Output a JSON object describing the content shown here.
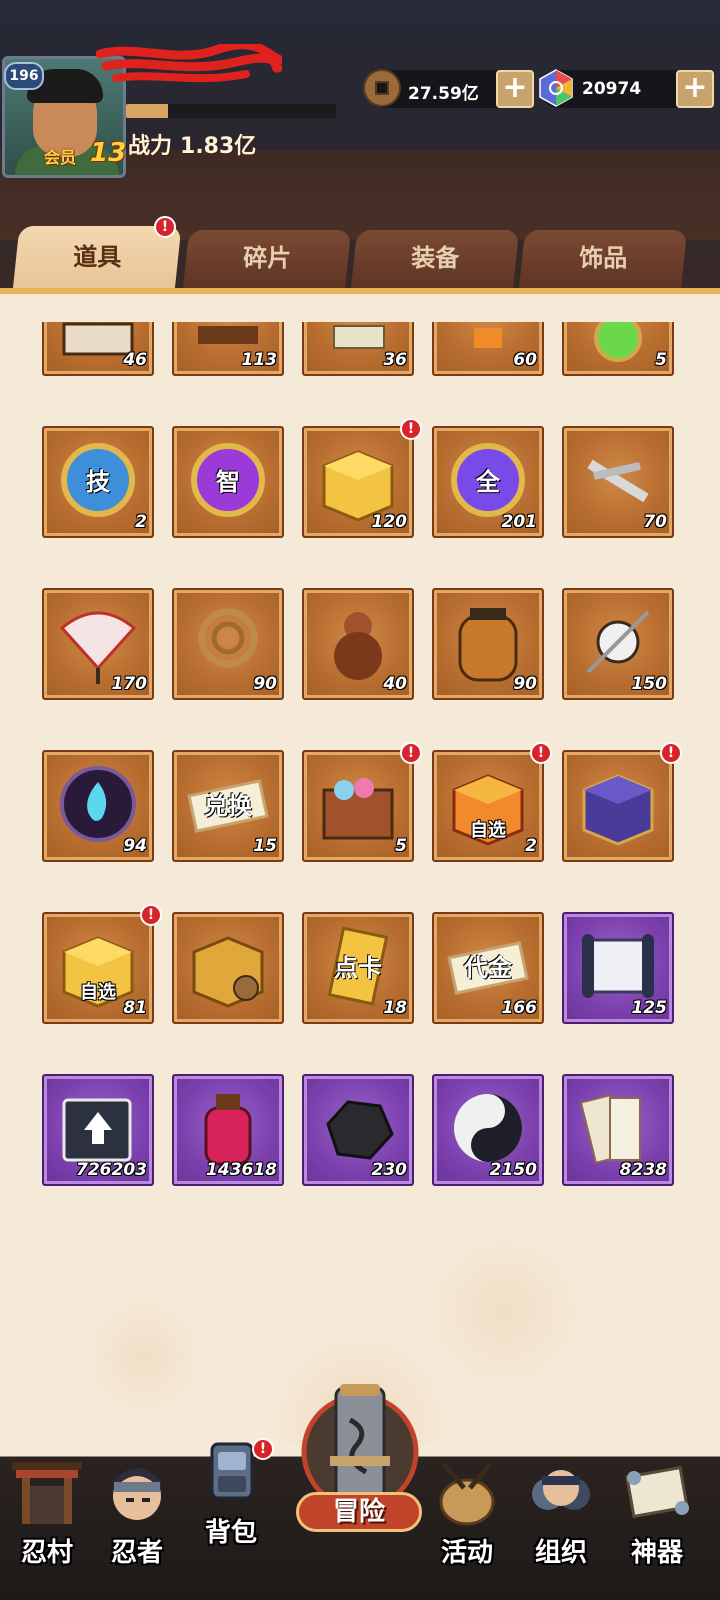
{
  "player": {
    "level": "196",
    "vip_label": "会员",
    "vip_level": "13",
    "power_label": "战力",
    "power_value": "1.83亿"
  },
  "currencies": [
    {
      "icon": "copper-coin-icon",
      "amount": "27.59亿",
      "plus": "+"
    },
    {
      "icon": "rainbow-gem-icon",
      "amount": "20974",
      "plus": "+"
    }
  ],
  "tabs": [
    {
      "label": "道具",
      "active": true,
      "alert": "!"
    },
    {
      "label": "碎片",
      "active": false
    },
    {
      "label": "装备",
      "active": false
    },
    {
      "label": "饰品",
      "active": false
    }
  ],
  "items": [
    {
      "name": "item-partial-1",
      "qty": "46",
      "color": "orange",
      "icon": "shield-fragment-icon"
    },
    {
      "name": "item-partial-2",
      "qty": "113",
      "color": "orange",
      "icon": "wood-plank-icon"
    },
    {
      "name": "item-partial-3",
      "qty": "36",
      "color": "orange",
      "icon": "paper-icon"
    },
    {
      "name": "item-partial-4",
      "qty": "60",
      "color": "orange",
      "icon": "orange-item-icon"
    },
    {
      "name": "item-partial-5",
      "qty": "5",
      "color": "orange",
      "icon": "green-orb-icon"
    },
    {
      "name": "skill-scroll",
      "qty": "2",
      "color": "orange",
      "icon": "skill-orb-icon",
      "glyph": "技"
    },
    {
      "name": "wisdom-orb",
      "qty": "",
      "color": "orange",
      "icon": "wisdom-orb-icon",
      "glyph": "智"
    },
    {
      "name": "gold-box",
      "qty": "120",
      "color": "orange",
      "icon": "gold-box-icon",
      "alert": "!"
    },
    {
      "name": "all-orb",
      "qty": "201",
      "color": "orange",
      "icon": "all-orb-icon",
      "glyph": "全"
    },
    {
      "name": "kunai-bundle",
      "qty": "70",
      "color": "orange",
      "icon": "kunai-icon"
    },
    {
      "name": "war-fan",
      "qty": "170",
      "color": "orange",
      "icon": "fan-icon"
    },
    {
      "name": "rope-coil",
      "qty": "90",
      "color": "orange",
      "icon": "rope-icon"
    },
    {
      "name": "gourd",
      "qty": "40",
      "color": "orange",
      "icon": "gourd-icon"
    },
    {
      "name": "sake-jar",
      "qty": "90",
      "color": "orange",
      "icon": "jar-icon"
    },
    {
      "name": "needle-scroll",
      "qty": "150",
      "color": "orange",
      "icon": "needle-icon"
    },
    {
      "name": "blue-flame-orb",
      "qty": "94",
      "color": "orange",
      "icon": "flame-orb-icon"
    },
    {
      "name": "voucher-ticket",
      "qty": "15",
      "color": "orange",
      "icon": "ticket-icon",
      "glyph": "兑换"
    },
    {
      "name": "treasure-chest",
      "qty": "5",
      "color": "orange",
      "icon": "chest-icon",
      "alert": "!"
    },
    {
      "name": "select-gift-box",
      "qty": "2",
      "color": "orange",
      "icon": "red-gift-box-icon",
      "tag": "自选",
      "alert": "!"
    },
    {
      "name": "purple-box",
      "qty": "",
      "color": "orange",
      "icon": "purple-box-icon",
      "alert": "!"
    },
    {
      "name": "select-gold-box",
      "qty": "81",
      "color": "orange",
      "icon": "gold-box-icon",
      "tag": "自选",
      "alert": "!"
    },
    {
      "name": "coin-box",
      "qty": "",
      "color": "orange",
      "icon": "coin-box-icon"
    },
    {
      "name": "point-card",
      "qty": "18",
      "color": "orange",
      "icon": "card-icon",
      "glyph": "点卡"
    },
    {
      "name": "gold-voucher",
      "qty": "166",
      "color": "orange",
      "icon": "ticket-icon",
      "glyph": "代金"
    },
    {
      "name": "scroll",
      "qty": "125",
      "color": "purple",
      "icon": "scroll-icon"
    },
    {
      "name": "exp-book",
      "qty": "726203",
      "color": "purple",
      "icon": "book-icon"
    },
    {
      "name": "chakra-bottle",
      "qty": "143618",
      "color": "purple",
      "icon": "bottle-icon"
    },
    {
      "name": "black-stone",
      "qty": "230",
      "color": "purple",
      "icon": "stone-icon"
    },
    {
      "name": "yin-yang",
      "qty": "2150",
      "color": "purple",
      "icon": "yin-yang-icon"
    },
    {
      "name": "talisman-papers",
      "qty": "8238",
      "color": "purple",
      "icon": "talisman-icon"
    }
  ],
  "nav": [
    {
      "label": "忍村",
      "icon": "village-gate-icon"
    },
    {
      "label": "忍者",
      "icon": "ninja-icon"
    },
    {
      "label": "背包",
      "icon": "backpack-icon",
      "alert": "!"
    },
    {
      "label": "冒险",
      "icon": "scroll-adventure-icon"
    },
    {
      "label": "活动",
      "icon": "drum-icon"
    },
    {
      "label": "组织",
      "icon": "group-icon"
    },
    {
      "label": "神器",
      "icon": "artifact-scroll-icon"
    }
  ],
  "colors": {
    "slot_orange": "#b86e30",
    "slot_purple": "#7b40ad",
    "alert_red": "#d8232a",
    "tab_active": "#f3d8b0",
    "tab_inactive": "#6b3e2c"
  }
}
